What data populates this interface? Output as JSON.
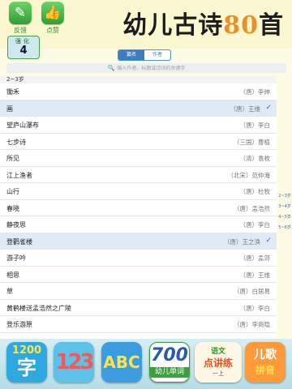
{
  "header": {
    "feedback": {
      "label": "反馈",
      "icon": "edit-icon"
    },
    "like": {
      "label": "点赞",
      "icon": "thumbs-up-icon"
    },
    "app_title_main": "幼儿古诗",
    "app_title_num": "80",
    "app_title_end": "首",
    "badge": {
      "label": "强化",
      "value": "4"
    }
  },
  "segment": {
    "tabs": [
      "篇名",
      "作者"
    ],
    "active": 0
  },
  "search": {
    "placeholder": "输入作者、标题或诗词的关键字"
  },
  "section_header": "2~3岁",
  "poems": [
    {
      "title": "锄禾",
      "author": "（唐）李绅",
      "selected": false
    },
    {
      "title": "画",
      "author": "（唐）王维",
      "selected": true
    },
    {
      "title": "望庐山瀑布",
      "author": "（唐）李白",
      "selected": false
    },
    {
      "title": "七步诗",
      "author": "（三国）曹植",
      "selected": false
    },
    {
      "title": "所见",
      "author": "（清）袁枚",
      "selected": false
    },
    {
      "title": "江上渔者",
      "author": "（北宋）范仲淹",
      "selected": false
    },
    {
      "title": "山行",
      "author": "（唐）杜牧",
      "selected": false
    },
    {
      "title": "春晓",
      "author": "（唐）孟浩然",
      "selected": false
    },
    {
      "title": "静夜思",
      "author": "（唐）李白",
      "selected": false
    },
    {
      "title": "登鹳雀楼",
      "author": "（唐）王之涣",
      "selected": true
    },
    {
      "title": "游子吟",
      "author": "（唐）孟郊",
      "selected": false
    },
    {
      "title": "相思",
      "author": "（唐）王维",
      "selected": false
    },
    {
      "title": "草",
      "author": "（唐）白居易",
      "selected": false
    },
    {
      "title": "黄鹤楼送孟浩然之广陵",
      "author": "（唐）李白",
      "selected": false
    },
    {
      "title": "登乐游原",
      "author": "（唐）李商隐",
      "selected": false
    }
  ],
  "section_index": [
    "2~3岁",
    "3~4岁",
    "4~5岁",
    "5~6岁"
  ],
  "app_bar": {
    "app1": {
      "top": "1200",
      "main": "字"
    },
    "app2": {
      "main": "123"
    },
    "app3": {
      "main": "ABC"
    },
    "app4": {
      "num": "700",
      "sub": "幼儿单词"
    },
    "app5": {
      "top": "语文",
      "mid": "点讲练",
      "sub": "一上"
    },
    "app6": {
      "main": "儿歌",
      "sub": "拼音"
    }
  },
  "colors": {
    "accent": "#3a7fc4",
    "title_accent": "#e8902a",
    "header_bg": "#fbf7d0",
    "selected_row": "#dfeaf7"
  }
}
